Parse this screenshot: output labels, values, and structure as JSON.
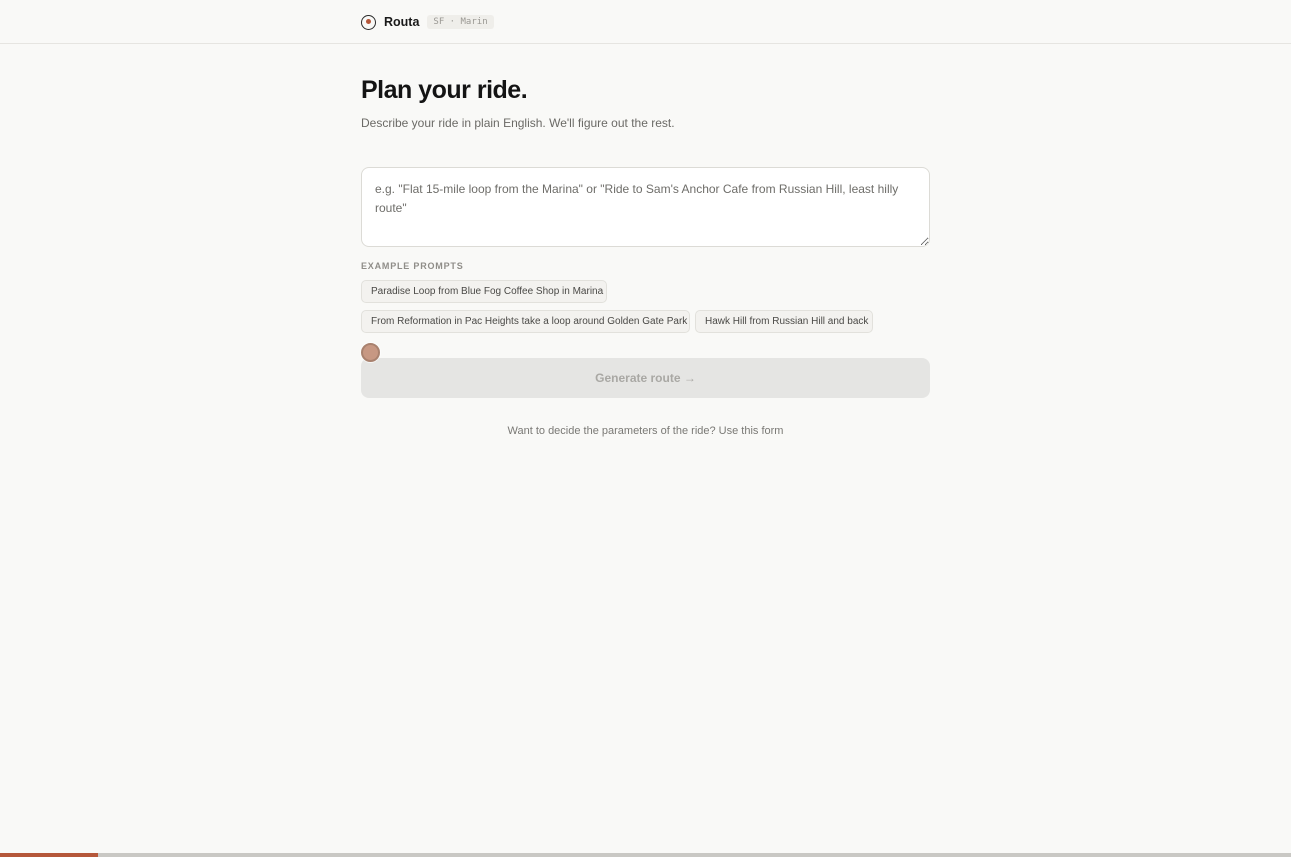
{
  "header": {
    "brand_name": "Routa",
    "region_badge": "SF · Marin",
    "logo_icon": "bicycle-wheel-icon"
  },
  "main": {
    "title": "Plan your ride.",
    "subtitle": "Describe your ride in plain English. We'll figure out the rest.",
    "prompt": {
      "value": "",
      "placeholder": "e.g. \"Flat 15-mile loop from the Marina\" or \"Ride to Sam's Anchor Cafe from Russian Hill, least hilly route\""
    },
    "examples_label": "EXAMPLE PROMPTS",
    "examples": [
      "Paradise Loop from Blue Fog Coffee Shop in Marina",
      "From Reformation in Pac Heights take a loop around Golden Gate Park",
      "Hawk Hill from Russian Hill and back"
    ],
    "generate_label": "Generate route →",
    "form_link_text": "Want to decide the parameters of the ride? Use this form"
  },
  "progress": {
    "fraction": 0.076
  },
  "colors": {
    "accent": "#b5573a",
    "background": "#f9f9f7",
    "button_disabled": "#e5e5e3"
  }
}
